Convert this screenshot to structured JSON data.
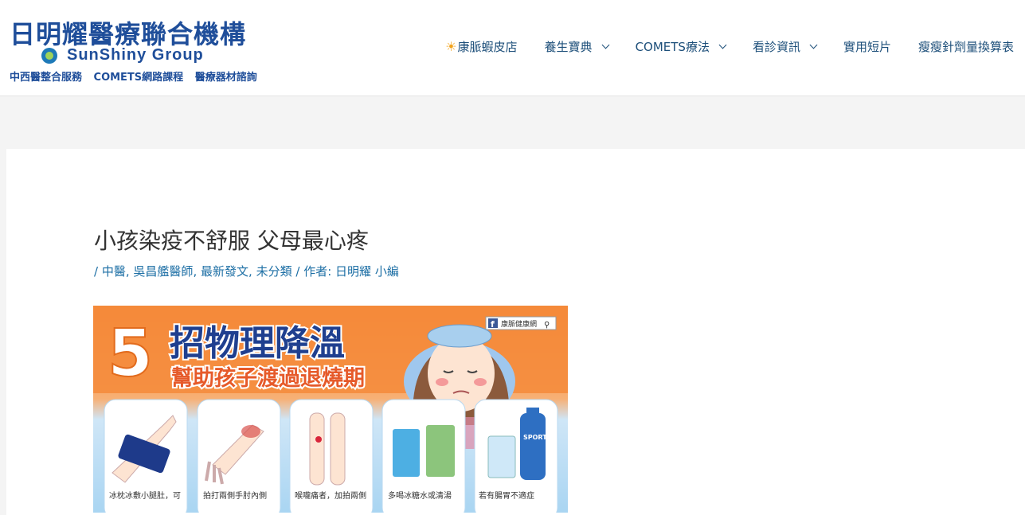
{
  "header": {
    "logo": {
      "title": "日明耀醫療聯合機構",
      "group": "SunShiny Group",
      "tagline": "中西醫整合服務 COMETS網路課程 醫療器材諮詢"
    },
    "nav": [
      {
        "label": "康脈蝦皮店",
        "icon": "sun-icon",
        "dropdown": false
      },
      {
        "label": "養生寶典",
        "dropdown": true
      },
      {
        "label": "COMETS療法",
        "dropdown": true
      },
      {
        "label": "看診資訊",
        "dropdown": true
      },
      {
        "label": "實用短片",
        "dropdown": false
      },
      {
        "label": "瘦瘦針劑量換算表",
        "dropdown": false
      }
    ]
  },
  "post": {
    "title": "小孩染疫不舒服 父母最心疼",
    "meta": {
      "lead": "/",
      "categories": [
        "中醫",
        "吳昌艦醫師",
        "最新發文",
        "未分類"
      ],
      "author_prefix": "/ 作者:",
      "author": "日明耀 小編"
    },
    "hero": {
      "big_number": "5",
      "headline": "招物理降溫",
      "subheadline": "幫助孩子渡過退燒期",
      "badge": "康脈健康網",
      "captions": [
        "冰枕冰敷小腿肚，可",
        "拍打兩側手肘內側",
        "喉嚨痛者，加拍兩側",
        "多喝冰糖水或清湯",
        "若有腸胃不適症"
      ],
      "drink_label": "SPORTS"
    }
  },
  "colors": {
    "brand": "#1f4e9a",
    "nav": "#1d4f7a",
    "link": "#1d6fa5",
    "hero_orange": "#f58a3a",
    "hero_blue": "#a9d5f2"
  }
}
